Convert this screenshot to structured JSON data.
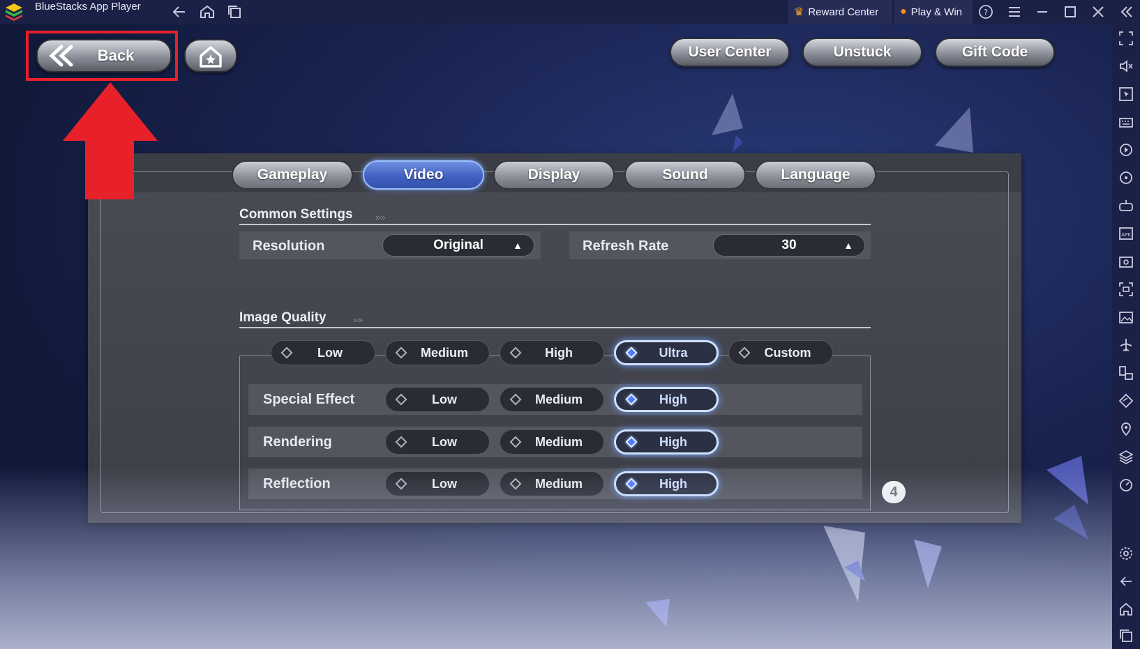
{
  "window": {
    "title": "BlueStacks App Player",
    "reward_center": "Reward Center",
    "play_win": "Play & Win"
  },
  "game": {
    "back_label": "Back",
    "top_buttons": [
      "User Center",
      "Unstuck",
      "Gift Code"
    ],
    "tabs": [
      "Gameplay",
      "Video",
      "Display",
      "Sound",
      "Language"
    ],
    "active_tab": "Video",
    "common_settings": {
      "title": "Common Settings",
      "resolution_label": "Resolution",
      "resolution_value": "Original",
      "refresh_label": "Refresh Rate",
      "refresh_value": "30"
    },
    "image_quality": {
      "title": "Image Quality",
      "presets": [
        "Low",
        "Medium",
        "High",
        "Ultra",
        "Custom"
      ],
      "selected_preset": "Ultra",
      "rows": [
        {
          "label": "Special Effect",
          "options": [
            "Low",
            "Medium",
            "High"
          ],
          "selected": "High"
        },
        {
          "label": "Rendering",
          "options": [
            "Low",
            "Medium",
            "High"
          ],
          "selected": "High"
        },
        {
          "label": "Reflection",
          "options": [
            "Low",
            "Medium",
            "High"
          ],
          "selected": "High"
        }
      ]
    },
    "badge": "4"
  },
  "colors": {
    "accent": "#4c7cff",
    "highlight": "#e8202a",
    "titlebar": "#1b2046"
  },
  "icons": [
    "bluestacks-logo-icon",
    "back-arrow-icon",
    "home-icon",
    "multi-instance-icon",
    "crown-icon",
    "coin-icon",
    "help-icon",
    "menu-icon",
    "minimize-icon",
    "maximize-icon",
    "close-icon",
    "collapse-icon"
  ]
}
